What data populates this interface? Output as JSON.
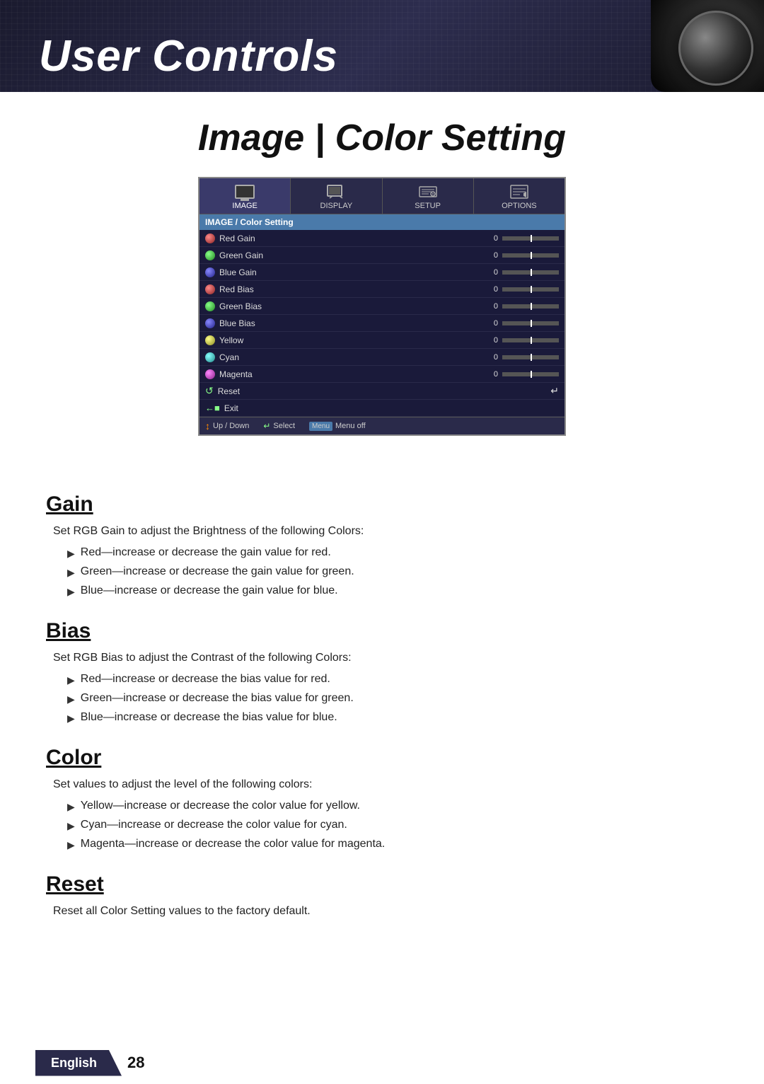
{
  "header": {
    "title": "User Controls",
    "subtitle": "Image | Color Setting"
  },
  "menu": {
    "tabs": [
      {
        "label": "IMAGE",
        "active": true
      },
      {
        "label": "DISPLAY",
        "active": false
      },
      {
        "label": "SETUP",
        "active": false
      },
      {
        "label": "OPTIONS",
        "active": false
      }
    ],
    "section_header": "IMAGE / Color Setting",
    "items": [
      {
        "name": "Red Gain",
        "value": "0",
        "dot": "red"
      },
      {
        "name": "Green Gain",
        "value": "0",
        "dot": "green"
      },
      {
        "name": "Blue Gain",
        "value": "0",
        "dot": "blue"
      },
      {
        "name": "Red Bias",
        "value": "0",
        "dot": "red"
      },
      {
        "name": "Green Bias",
        "value": "0",
        "dot": "green"
      },
      {
        "name": "Blue Bias",
        "value": "0",
        "dot": "blue"
      },
      {
        "name": "Yellow",
        "value": "0",
        "dot": "yellow"
      },
      {
        "name": "Cyan",
        "value": "0",
        "dot": "cyan"
      },
      {
        "name": "Magenta",
        "value": "0",
        "dot": "magenta"
      }
    ],
    "actions": [
      {
        "name": "Reset",
        "type": "reset"
      },
      {
        "name": "Exit",
        "type": "exit"
      }
    ],
    "status": {
      "updown": "Up / Down",
      "select": "Select",
      "menuoff": "Menu off"
    }
  },
  "sections": {
    "gain": {
      "title": "Gain",
      "intro": "Set RGB Gain to adjust the Brightness of the following Colors:",
      "bullets": [
        "Red—increase or decrease the gain value for red.",
        "Green—increase or decrease the gain value for green.",
        "Blue—increase or decrease the gain value for blue."
      ]
    },
    "bias": {
      "title": "Bias",
      "intro": "Set RGB Bias to adjust the Contrast of the following Colors:",
      "bullets": [
        "Red—increase or decrease the bias value for red.",
        "Green—increase or decrease the bias value for green.",
        "Blue—increase or decrease the bias value for blue."
      ]
    },
    "color": {
      "title": "Color",
      "intro": "Set values to adjust the level of the following colors:",
      "bullets": [
        "Yellow—increase or decrease the color value for yellow.",
        "Cyan—increase or decrease the color value for cyan.",
        "Magenta—increase or decrease the color value for magenta."
      ]
    },
    "reset": {
      "title": "Reset",
      "intro": "Reset all Color Setting values to the factory default."
    }
  },
  "footer": {
    "language": "English",
    "page": "28"
  }
}
